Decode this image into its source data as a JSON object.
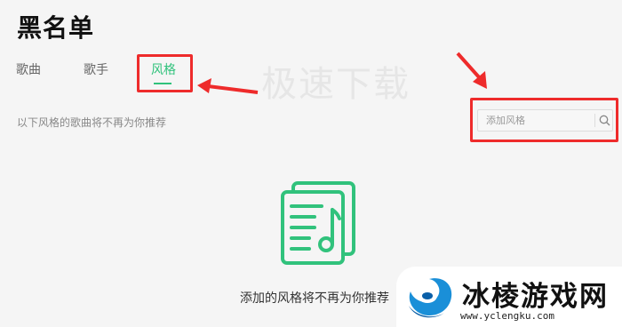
{
  "page": {
    "title": "黑名单"
  },
  "tabs": [
    {
      "label": "歌曲",
      "active": false
    },
    {
      "label": "歌手",
      "active": false
    },
    {
      "label": "风格",
      "active": true
    }
  ],
  "watermark": {
    "center_text": "极速下载"
  },
  "hint": {
    "text": "以下风格的歌曲将不再为你推荐"
  },
  "search": {
    "placeholder": "添加风格",
    "icon": "search-icon"
  },
  "empty_state": {
    "icon": "music-sheet-icon",
    "text": "添加的风格将不再为你推荐"
  },
  "site_badge": {
    "name": "冰棱游戏网",
    "url": "www.yclengku.com"
  },
  "colors": {
    "accent": "#31c27c",
    "annotation": "#ee2b2b",
    "background": "#f5f5f5"
  }
}
